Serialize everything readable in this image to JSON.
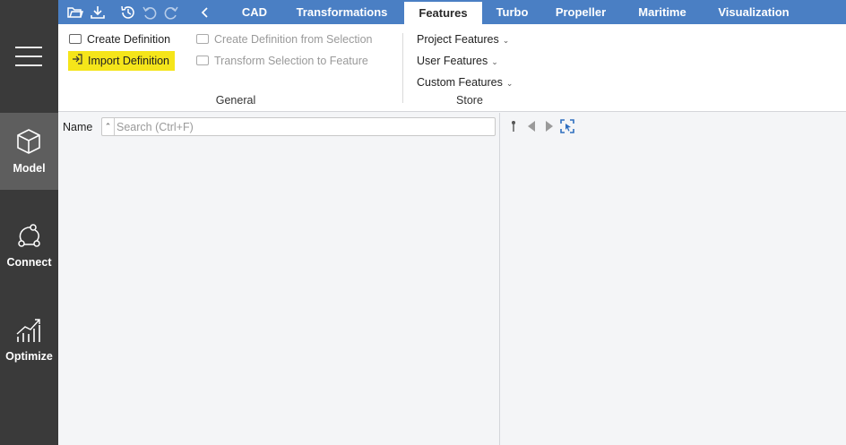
{
  "sidebar": {
    "menu_icon": "hamburger-icon",
    "items": [
      {
        "label": "Model",
        "icon": "cube-icon",
        "active": true
      },
      {
        "label": "Connect",
        "icon": "connect-nodes-icon",
        "active": false
      },
      {
        "label": "Optimize",
        "icon": "chart-trend-icon",
        "active": false
      }
    ]
  },
  "quick_access": [
    "open-folder-icon",
    "download-icon",
    "history-icon",
    "undo-icon",
    "redo-icon",
    "chevron-left-icon"
  ],
  "tabs": [
    {
      "label": "CAD",
      "active": false
    },
    {
      "label": "Transformations",
      "active": false
    },
    {
      "label": "Features",
      "active": true
    },
    {
      "label": "Turbo",
      "active": false
    },
    {
      "label": "Propeller",
      "active": false
    },
    {
      "label": "Maritime",
      "active": false
    },
    {
      "label": "Visualization",
      "active": false
    }
  ],
  "ribbon": {
    "general": {
      "label": "General",
      "create_definition": "Create Definition",
      "import_definition": "Import Definition",
      "create_from_selection": "Create Definition from Selection",
      "transform_selection": "Transform Selection to Feature"
    },
    "store": {
      "label": "Store",
      "project_features": "Project Features",
      "user_features": "User Features",
      "custom_features": "Custom Features"
    }
  },
  "left_pane": {
    "name_label": "Name",
    "search_placeholder": "Search (Ctrl+F)",
    "search_value": ""
  },
  "right_pane": {
    "icons": [
      "pin-icon",
      "arrow-left-icon",
      "arrow-right-icon",
      "select-target-icon"
    ]
  },
  "colors": {
    "topbar": "#4a7fc4",
    "sidebar": "#3a3a3a",
    "sidebar_active": "#5e5e5e",
    "highlight": "#f5e51a"
  }
}
